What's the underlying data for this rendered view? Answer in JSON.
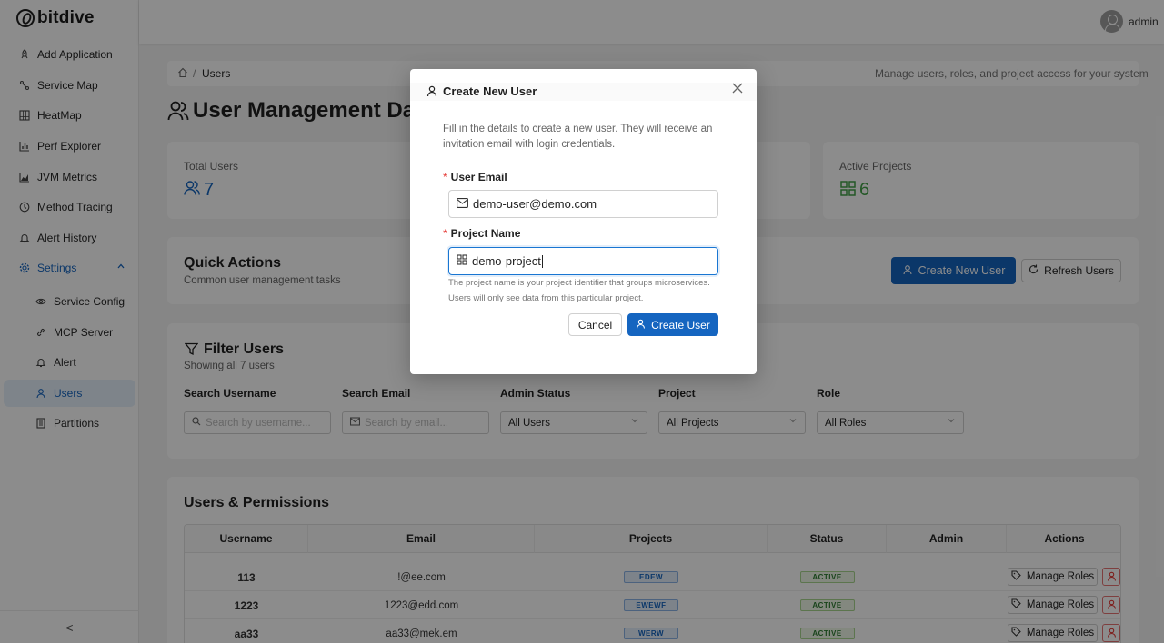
{
  "brand": {
    "name": "bitdive"
  },
  "sidebar": {
    "items": [
      {
        "label": "Add Application",
        "icon": "rocket-icon"
      },
      {
        "label": "Service Map",
        "icon": "network-icon"
      },
      {
        "label": "HeatMap",
        "icon": "heatmap-icon"
      },
      {
        "label": "Perf Explorer",
        "icon": "bar-chart-icon"
      },
      {
        "label": "JVM Metrics",
        "icon": "area-chart-icon"
      },
      {
        "label": "Method Tracing",
        "icon": "clock-icon"
      },
      {
        "label": "Alert History",
        "icon": "bell-icon"
      },
      {
        "label": "Settings",
        "icon": "gear-icon"
      }
    ],
    "sub_items": [
      {
        "label": "Service Config",
        "icon": "eye-icon"
      },
      {
        "label": "MCP Server",
        "icon": "link-icon"
      },
      {
        "label": "Alert",
        "icon": "bell-icon"
      },
      {
        "label": "Users",
        "icon": "user-icon"
      },
      {
        "label": "Partitions",
        "icon": "document-icon"
      }
    ],
    "collapse_glyph": "<"
  },
  "header": {
    "username": "admin"
  },
  "breadcrumb": {
    "separator": "/",
    "current": "Users",
    "description": "Manage users, roles, and project access for your system"
  },
  "page": {
    "title": "User Management Dashboard"
  },
  "stats": {
    "total_users": {
      "label": "Total Users",
      "value": "7"
    },
    "active_projects": {
      "label": "Active Projects",
      "value": "6"
    }
  },
  "quick_actions": {
    "title": "Quick Actions",
    "subtitle": "Common user management tasks",
    "create_label": "Create New User",
    "refresh_label": "Refresh Users"
  },
  "filters": {
    "title": "Filter Users",
    "subtitle": "Showing all 7 users",
    "search_username": {
      "label": "Search Username",
      "placeholder": "Search by username..."
    },
    "search_email": {
      "label": "Search Email",
      "placeholder": "Search by email..."
    },
    "admin_status": {
      "label": "Admin Status",
      "value": "All Users"
    },
    "project": {
      "label": "Project",
      "value": "All Projects"
    },
    "role": {
      "label": "Role",
      "value": "All Roles"
    }
  },
  "table": {
    "title": "Users & Permissions",
    "columns": [
      "Username",
      "Email",
      "Projects",
      "Status",
      "Admin",
      "Actions"
    ],
    "action_label": "Manage Roles",
    "rows": [
      {
        "username": "113",
        "email": "!@ee.com",
        "project": "EDEW",
        "status": "ACTIVE"
      },
      {
        "username": "1223",
        "email": "1223@edd.com",
        "project": "EWEWF",
        "status": "ACTIVE"
      },
      {
        "username": "aa33",
        "email": "aa33@mek.em",
        "project": "WERW",
        "status": "ACTIVE"
      }
    ]
  },
  "modal": {
    "title": "Create New User",
    "description": "Fill in the details to create a new user. They will receive an invitation email with login credentials.",
    "required_mark": "*",
    "email_label": "User Email",
    "email_value": "demo-user@demo.com",
    "project_label": "Project Name",
    "project_value": "demo-project",
    "help": "The project name is your project identifier that groups microservices. Users will only see data from this particular project.",
    "cancel_label": "Cancel",
    "submit_label": "Create User"
  },
  "colors": {
    "primary": "#1565c0",
    "active_green": "#2e7d32",
    "danger": "#e53935"
  }
}
